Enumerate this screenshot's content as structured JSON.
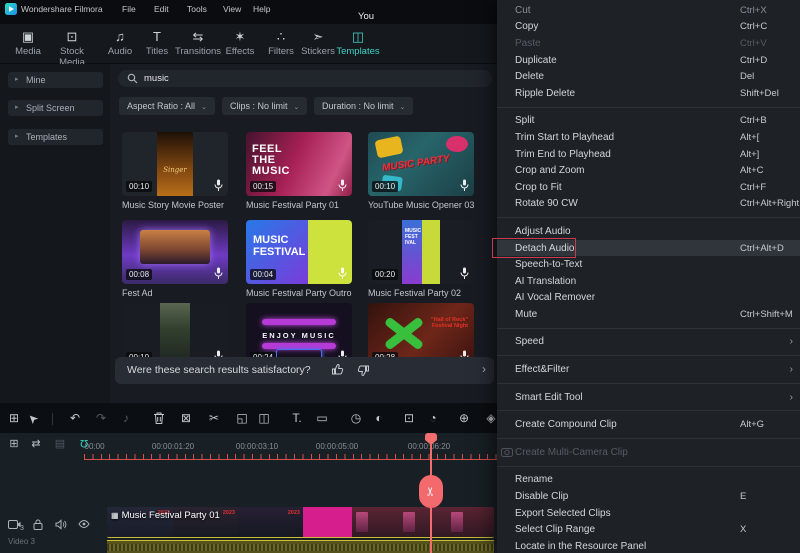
{
  "titlebar": {
    "app_title": "Wondershare Filmora",
    "menus": [
      "File",
      "Edit",
      "Tools",
      "View",
      "Help"
    ],
    "center_text": "You"
  },
  "tabs": [
    {
      "label": "Media"
    },
    {
      "label": "Stock Media"
    },
    {
      "label": "Audio"
    },
    {
      "label": "Titles"
    },
    {
      "label": "Transitions"
    },
    {
      "label": "Effects"
    },
    {
      "label": "Filters"
    },
    {
      "label": "Stickers"
    },
    {
      "label": "Templates",
      "active": true
    }
  ],
  "sidebar": {
    "items": [
      {
        "label": "Mine"
      },
      {
        "label": "Split Screen"
      },
      {
        "label": "Templates"
      }
    ]
  },
  "library": {
    "search_value": "music",
    "filters": [
      {
        "label": "Aspect Ratio : All"
      },
      {
        "label": "Clips : No limit"
      },
      {
        "label": "Duration : No limit"
      }
    ],
    "templates": [
      {
        "name": "Music Story Movie Poster",
        "duration": "00:10",
        "thumb_text": "Singer"
      },
      {
        "name": "Music Festival Party 01",
        "duration": "00:15",
        "lines": [
          "FEEL",
          "THE",
          "MUSIC"
        ]
      },
      {
        "name": "YouTube Music Opener 03",
        "duration": "00:10",
        "thumb_text": "MUSIC PARTY"
      },
      {
        "name": "Fest Ad",
        "duration": "00:08"
      },
      {
        "name": "Music Festival Party Outro",
        "duration": "00:04",
        "lines": [
          "MUSIC",
          "FESTIVAL"
        ]
      },
      {
        "name": "Music Festival Party 02",
        "duration": "00:20",
        "lines": [
          "MUSIC",
          "FEST",
          "IVAL"
        ]
      },
      {
        "duration": "00:10"
      },
      {
        "duration": "00:24",
        "thumb_text": "ENJOY MUSIC"
      },
      {
        "duration": "00:28",
        "lines": [
          "\"Hall of Rock\"",
          "Festival Night"
        ]
      }
    ],
    "feedback": {
      "question": "Were these search results satisfactory?"
    }
  },
  "timeline": {
    "ruler_labels": [
      "00:00:00",
      "00:00:01:20",
      "00:00:03:10",
      "00:00:05:00",
      "00:00:06:20"
    ],
    "track": {
      "number": "3",
      "name": "Video 3"
    },
    "clip": {
      "label": "Music Festival Party 01",
      "frame_text": "2023"
    }
  },
  "context_menu": {
    "items": [
      {
        "label": "Cut",
        "shortcut": "Ctrl+X"
      },
      {
        "label": "Copy",
        "shortcut": "Ctrl+C"
      },
      {
        "label": "Paste",
        "shortcut": "Ctrl+V"
      },
      {
        "label": "Duplicate",
        "shortcut": "Ctrl+D"
      },
      {
        "label": "Delete",
        "shortcut": "Del"
      },
      {
        "label": "Ripple Delete",
        "shortcut": "Shift+Del"
      },
      {
        "label": "Split",
        "shortcut": "Ctrl+B"
      },
      {
        "label": "Trim Start to Playhead",
        "shortcut": "Alt+["
      },
      {
        "label": "Trim End to Playhead",
        "shortcut": "Alt+]"
      },
      {
        "label": "Crop and Zoom",
        "shortcut": "Alt+C"
      },
      {
        "label": "Crop to Fit",
        "shortcut": "Ctrl+F"
      },
      {
        "label": "Rotate 90 CW",
        "shortcut": "Ctrl+Alt+Right"
      },
      {
        "label": "Adjust Audio",
        "shortcut": ""
      },
      {
        "label": "Detach Audio",
        "shortcut": "Ctrl+Alt+D",
        "highlighted": true
      },
      {
        "label": "Speech-to-Text",
        "shortcut": ""
      },
      {
        "label": "AI Translation",
        "shortcut": ""
      },
      {
        "label": "AI Vocal Remover",
        "shortcut": ""
      },
      {
        "label": "Mute",
        "shortcut": "Ctrl+Shift+M"
      },
      {
        "label": "Speed",
        "shortcut": ""
      },
      {
        "label": "Effect&Filter",
        "shortcut": ""
      },
      {
        "label": "Smart Edit Tool",
        "shortcut": ""
      },
      {
        "label": "Create Compound Clip",
        "shortcut": "Alt+G"
      },
      {
        "label": "Create Multi-Camera Clip",
        "shortcut": ""
      },
      {
        "label": "Rename",
        "shortcut": ""
      },
      {
        "label": "Disable Clip",
        "shortcut": "E"
      },
      {
        "label": "Export Selected Clips",
        "shortcut": ""
      },
      {
        "label": "Select Clip Range",
        "shortcut": "X"
      },
      {
        "label": "Locate in the Resource Panel",
        "shortcut": ""
      }
    ]
  },
  "icons": {
    "sidebar_chevron": "▸",
    "dropdown_caret": "⌄",
    "toast_chevron": "›",
    "submenu_arrow": "›",
    "clip_badge": "▦",
    "tab_media": "▣",
    "tab_stock": "⊡",
    "tab_audio": "♫",
    "tab_titles": "T",
    "tab_transitions": "⇆",
    "tab_effects": "✶",
    "tab_filters": "∴",
    "tab_stickers": "➣",
    "tab_templates": "◫",
    "tb_grid": "⊞",
    "tb_select": "➤",
    "tb_undo": "↶",
    "tb_redo": "↷",
    "tb_note": "♪",
    "tb_copyfx": "⊠",
    "tb_split": "✂",
    "tb_crop": "◱",
    "tb_trim": "◫",
    "tb_text": "T.",
    "tb_mask": "▭",
    "tb_speed": "◷",
    "tb_color": "◐",
    "tb_chroma": "⊡",
    "tb_freeze": "◔",
    "tb_marker": "⊕",
    "tb_keyframe": "◈",
    "tl_add": "⊞",
    "tl_link": "⇄",
    "tl_tracks": "▤",
    "tl_magnet": "Ω",
    "playhead_scissors": "✂"
  },
  "colors": {
    "accent_teal": "#3fd1c4",
    "playhead_red": "#f26d6d",
    "highlight_red": "#c63b4e",
    "selection_yellow": "#c9be35",
    "clip_magenta": "#d61f8d"
  }
}
